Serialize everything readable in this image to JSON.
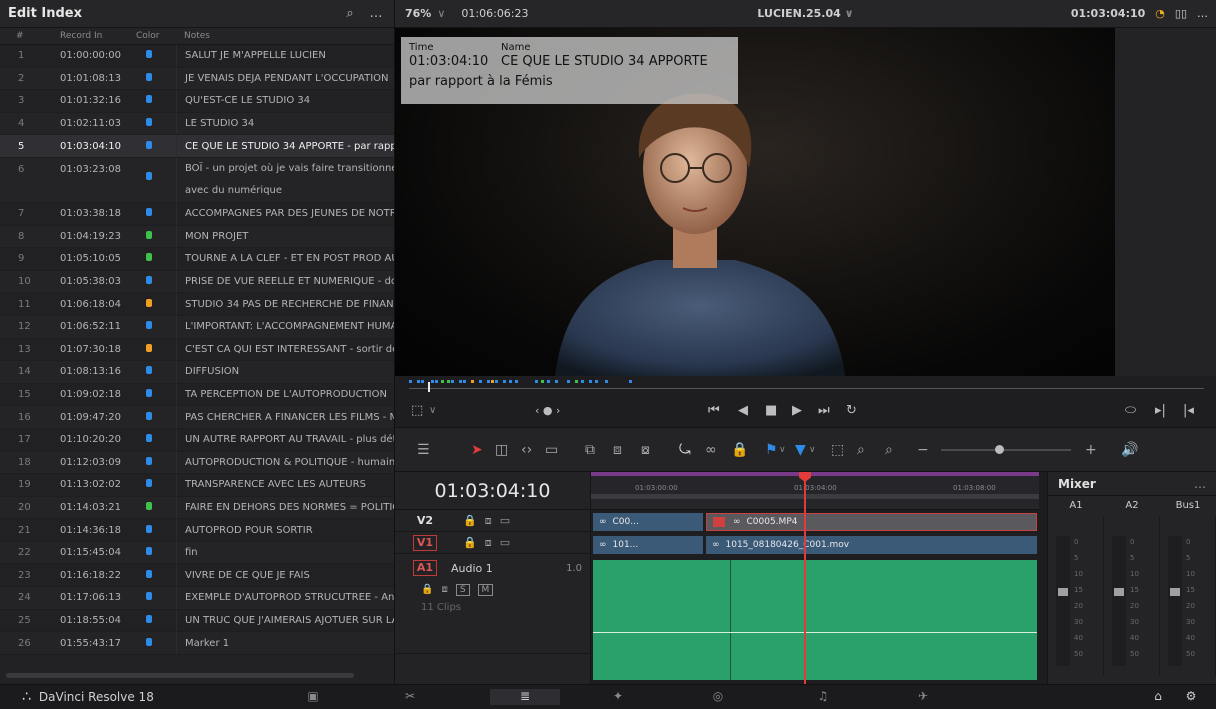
{
  "index": {
    "title": "Edit Index",
    "columns": {
      "num": "#",
      "record_in": "Record In",
      "color": "Color",
      "notes": "Notes"
    },
    "rows": [
      {
        "num": "1",
        "record_in": "01:00:00:00",
        "color": "#2f8be8",
        "notes": "SALUT JE M'APPELLE LUCIEN"
      },
      {
        "num": "2",
        "record_in": "01:01:08:13",
        "color": "#2f8be8",
        "notes": "JE VENAIS DEJA PENDANT L'OCCUPATION"
      },
      {
        "num": "3",
        "record_in": "01:01:32:16",
        "color": "#2f8be8",
        "notes": "QU'EST-CE LE STUDIO 34"
      },
      {
        "num": "4",
        "record_in": "01:02:11:03",
        "color": "#2f8be8",
        "notes": "LE STUDIO 34"
      },
      {
        "num": "5",
        "record_in": "01:03:04:10",
        "color": "#2f8be8",
        "notes": "CE QUE LE STUDIO 34 APPORTE - par rappo"
      },
      {
        "num": "6",
        "record_in": "01:03:23:08",
        "color": "#2f8be8",
        "notes": "BOÏ - un projet où je vais faire transitionner",
        "notes2": "avec du numérique"
      },
      {
        "num": "7",
        "record_in": "01:03:38:18",
        "color": "#2f8be8",
        "notes": "ACCOMPAGNES PAR DES JEUNES DE NOTRE"
      },
      {
        "num": "8",
        "record_in": "01:04:19:23",
        "color": "#3ec24a",
        "notes": "MON PROJET"
      },
      {
        "num": "9",
        "record_in": "01:05:10:05",
        "color": "#3ec24a",
        "notes": "TOURNE A LA CLEF - ET EN POST PROD AU S"
      },
      {
        "num": "10",
        "record_in": "01:05:38:03",
        "color": "#2f8be8",
        "notes": "PRISE DE VUE REELLE ET NUMERIQUE - don"
      },
      {
        "num": "11",
        "record_in": "01:06:18:04",
        "color": "#f0a020",
        "notes": "STUDIO 34 PAS DE RECHERCHE DE FINANCI"
      },
      {
        "num": "12",
        "record_in": "01:06:52:11",
        "color": "#2f8be8",
        "notes": "L'IMPORTANT: L'ACCOMPAGNEMENT HUMA"
      },
      {
        "num": "13",
        "record_in": "01:07:30:18",
        "color": "#f0a020",
        "notes": "C'EST CA QUI EST INTERESSANT - sortir des"
      },
      {
        "num": "14",
        "record_in": "01:08:13:16",
        "color": "#2f8be8",
        "notes": "DIFFUSION"
      },
      {
        "num": "15",
        "record_in": "01:09:02:18",
        "color": "#2f8be8",
        "notes": "TA PERCEPTION DE L'AUTOPRODUCTION"
      },
      {
        "num": "16",
        "record_in": "01:09:47:20",
        "color": "#2f8be8",
        "notes": "PAS CHERCHER A FINANCER LES FILMS - MA"
      },
      {
        "num": "17",
        "record_in": "01:10:20:20",
        "color": "#2f8be8",
        "notes": "UN AUTRE RAPPORT AU TRAVAIL - plus déte"
      },
      {
        "num": "18",
        "record_in": "01:12:03:09",
        "color": "#2f8be8",
        "notes": "AUTOPRODUCTION & POLITIQUE - humaine"
      },
      {
        "num": "19",
        "record_in": "01:13:02:02",
        "color": "#2f8be8",
        "notes": "TRANSPARENCE AVEC LES AUTEURS"
      },
      {
        "num": "20",
        "record_in": "01:14:03:21",
        "color": "#3ec24a",
        "notes": "FAIRE EN DEHORS DES NORMES = POLITIQU"
      },
      {
        "num": "21",
        "record_in": "01:14:36:18",
        "color": "#2f8be8",
        "notes": "AUTOPROD POUR SORTIR"
      },
      {
        "num": "22",
        "record_in": "01:15:45:04",
        "color": "#2f8be8",
        "notes": "fin"
      },
      {
        "num": "23",
        "record_in": "01:16:18:22",
        "color": "#2f8be8",
        "notes": "VIVRE DE CE QUE JE FAIS"
      },
      {
        "num": "24",
        "record_in": "01:17:06:13",
        "color": "#2f8be8",
        "notes": "EXEMPLE D'AUTOPROD STRUCUTREE - Ange"
      },
      {
        "num": "25",
        "record_in": "01:18:55:04",
        "color": "#2f8be8",
        "notes": "UN TRUC QUE J'AIMERAIS AJOTUER SUR LA"
      },
      {
        "num": "26",
        "record_in": "01:55:43:17",
        "color": "#2f8be8",
        "notes": "Marker 1"
      }
    ]
  },
  "viewer": {
    "zoom": "76%",
    "source_timecode": "01:06:06:23",
    "timeline_name": "LUCIEN.25.04",
    "record_timecode": "01:03:04:10",
    "overlay": {
      "time_label": "Time",
      "name_label": "Name",
      "time_value": "01:03:04:10",
      "name_value": "CE QUE LE STUDIO 34 APPORTE",
      "note": "par rapport à la Fémis"
    }
  },
  "timeline": {
    "timecode": "01:03:04:10",
    "ruler": [
      "01:03:00:00",
      "01:03:04:00",
      "01:03:08:00"
    ],
    "tracks": {
      "v2": "V2",
      "v1": "V1",
      "a1": "A1",
      "a1_name": "Audio 1",
      "a1_volume": "1.0",
      "a1_clips": "11 Clips"
    },
    "clips": {
      "v2a": "C00...",
      "v2b": "C0005.MP4",
      "v1a": "101...",
      "v1b": "1015_08180426_C001.mov"
    }
  },
  "mixer": {
    "title": "Mixer",
    "channels": [
      "A1",
      "A2",
      "Bus1"
    ],
    "scale": [
      "0",
      "5",
      "10",
      "15",
      "20",
      "30",
      "40",
      "50"
    ]
  },
  "app": {
    "name": "DaVinci Resolve 18"
  }
}
